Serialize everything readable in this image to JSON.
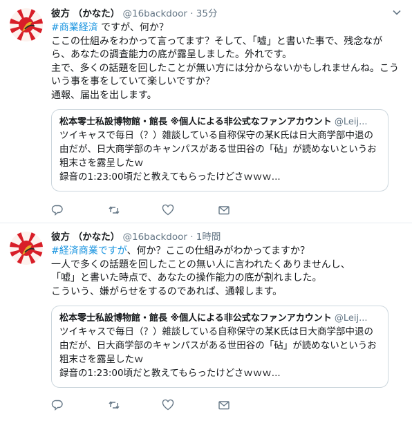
{
  "tweets": [
    {
      "name": "彼方 （かなた）",
      "handle": "@16backdoor",
      "dot": "·",
      "time": "35分",
      "hashtag": "#商業経済",
      "lines": [
        " ですが、何か？",
        "ここの仕組みをわかって言ってます？そして、「嘘」と書いた事で、残念なが",
        "ら、あなたの調査能力の底が露呈しました。外れです。",
        "主で、多くの話題を回したことが無い方には分からないかもしれませんね。こう",
        "いう事を事をしていて楽しいですか？",
        "通報、届出を出します。"
      ],
      "quote": {
        "name": "松本零士私設博物館・館長 ※個人による非公式なファンアカウント",
        "handle": "@Leij...",
        "lines": [
          "ツイキャスで毎日（？）雑談している自称保守の某K氏は日大商学部中退の",
          "由だが、日大商学部のキャンパスがある世田谷の「砧」が読めないというお",
          "粗末さを露呈したｗ",
          "録音の1:23:00頃だと教えてもらったけどさｗｗｗ..."
        ]
      }
    },
    {
      "name": "彼方 （かなた）",
      "handle": "@16backdoor",
      "dot": "·",
      "time": "1時間",
      "hashtag": "#経済商業ですが",
      "lines": [
        "、何か？ここの仕組みがわかってますか？",
        "一人で多くの話題を回したことの無い人に言われたくありませんし、",
        "「嘘」と書いた時点で、あなたの操作能力の底が割れました。",
        "こういう、嫌がらせをするのであれば、通報します。"
      ],
      "quote": {
        "name": "松本零士私設博物館・館長 ※個人による非公式なファンアカウント",
        "handle": "@Leij...",
        "lines": [
          "ツイキャスで毎日（？）雑談している自称保守の某K氏は日大商学部中退の",
          "由だが、日大商学部のキャンパスがある世田谷の「砧」が読めないというお",
          "粗末さを露呈したｗ",
          "録音の1:23:00頃だと教えてもらったけどさｗｗｗ..."
        ]
      }
    }
  ],
  "icons": {
    "reply": "reply-icon",
    "retweet": "retweet-icon",
    "like": "heart-icon",
    "dm": "envelope-icon",
    "caret": "chevron-down-icon",
    "avatar": "rising-sun-avatar"
  },
  "colors": {
    "link": "#1b95e0",
    "secondary": "#657786",
    "border": "#ccd6dd"
  }
}
